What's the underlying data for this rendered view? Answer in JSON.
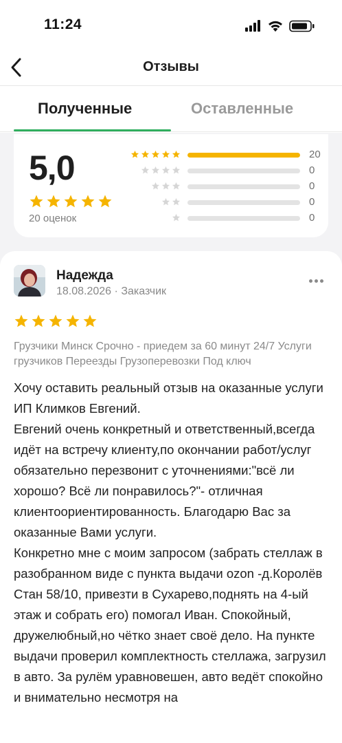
{
  "status_bar": {
    "time": "11:24"
  },
  "header": {
    "title": "Отзывы"
  },
  "tabs": [
    {
      "label": "Полученные",
      "active": true
    },
    {
      "label": "Оставленные",
      "active": false
    }
  ],
  "summary": {
    "average": "5,0",
    "count_label": "20 оценок",
    "distribution": [
      {
        "stars": 5,
        "count": 20,
        "fraction": 1.0
      },
      {
        "stars": 4,
        "count": 0,
        "fraction": 0
      },
      {
        "stars": 3,
        "count": 0,
        "fraction": 0
      },
      {
        "stars": 2,
        "count": 0,
        "fraction": 0
      },
      {
        "stars": 1,
        "count": 0,
        "fraction": 0
      }
    ]
  },
  "review": {
    "author": "Надежда",
    "date": "18.08.2026",
    "role": "Заказчик",
    "rating": 5,
    "service": "Грузчики Минск Срочно - приедем за 60 минут 24/7 Услуги грузчиков Переезды Грузоперевозки Под ключ",
    "text": "Хочу оставить реальный отзыв на оказанные услуги ИП Климков Евгений.\nЕвгений очень конкретный и ответственный,всегда идёт на встречу клиенту,по окончании работ/услуг обязательно перезвонит с уточнениями:\"всё ли хорошо? Всё ли понравилось?\"- отличная клиентоориентированность. Благодарю Вас за оказанные Вами услуги.\nКонкретно мне с моим запросом (забрать стеллаж в разобранном виде с пункта выдачи ozon -д.Королёв Стан 58/10, привезти в Сухарево,поднять на 4-ый этаж и собрать его) помогал Иван. Спокойный, дружелюбный,но чётко знает своё дело. На пункте выдачи проверил комплектность стеллажа, загрузил в авто. За рулём уравновешен, авто ведёт спокойно и внимательно несмотря на"
  },
  "colors": {
    "accent_green": "#2fae5e",
    "star_gold": "#f5b400",
    "star_empty": "#d6d6d6"
  },
  "icons": {
    "back": "chevron-left-icon",
    "signal": "signal-icon",
    "wifi": "wifi-icon",
    "battery": "battery-icon",
    "more": "more-dots-icon",
    "star": "star-icon"
  }
}
